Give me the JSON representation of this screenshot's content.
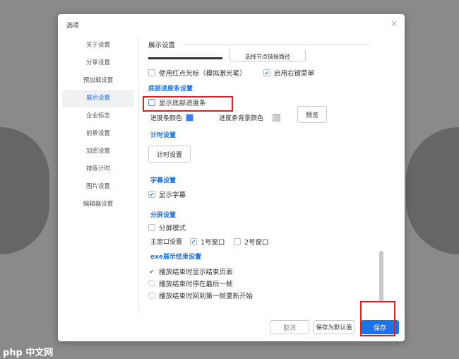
{
  "dialog": {
    "title": "选项",
    "close": "×"
  },
  "nav": [
    "关于设置",
    "分享设置",
    "预加载设置",
    "展示设置",
    "企业标志",
    "前景设置",
    "加密设置",
    "排练计时",
    "图片设置",
    "编辑器设置"
  ],
  "content": {
    "section_display": "展示设置",
    "link_path_button": "选择节点链接路径",
    "red_dot_cursor": "使用红点光标（模拟激光笔）",
    "right_menu": "启用右键菜单",
    "section_progress": "底部进度条设置",
    "show_progress": "显示底部进度条",
    "progress_color": "进度条颜色",
    "progress_bg_color": "进度条背景颜色",
    "preview": "预览",
    "section_timer": "计时设置",
    "timer_button": "计时设置",
    "section_subtitle": "字幕设置",
    "show_subtitle": "显示字幕",
    "section_split": "分屏设置",
    "split_mode": "分屏模式",
    "main_window": "主窗口设置",
    "window1": "1号窗口",
    "window2": "2号窗口",
    "section_exe": "exe展示结束设置",
    "end_opt1": "播放结束时显示结束页面",
    "end_opt2": "播放结束时停在最后一帧",
    "end_opt3": "播放结束时回到第一帧重新开始"
  },
  "footer": {
    "cancel": "取消",
    "save_default": "保存为默认值",
    "save": "保存"
  },
  "colors": {
    "accent": "#1a73e8",
    "progress": "#3b7bf0",
    "progress_bg": "#cccccc"
  },
  "watermark": "php 中文网"
}
